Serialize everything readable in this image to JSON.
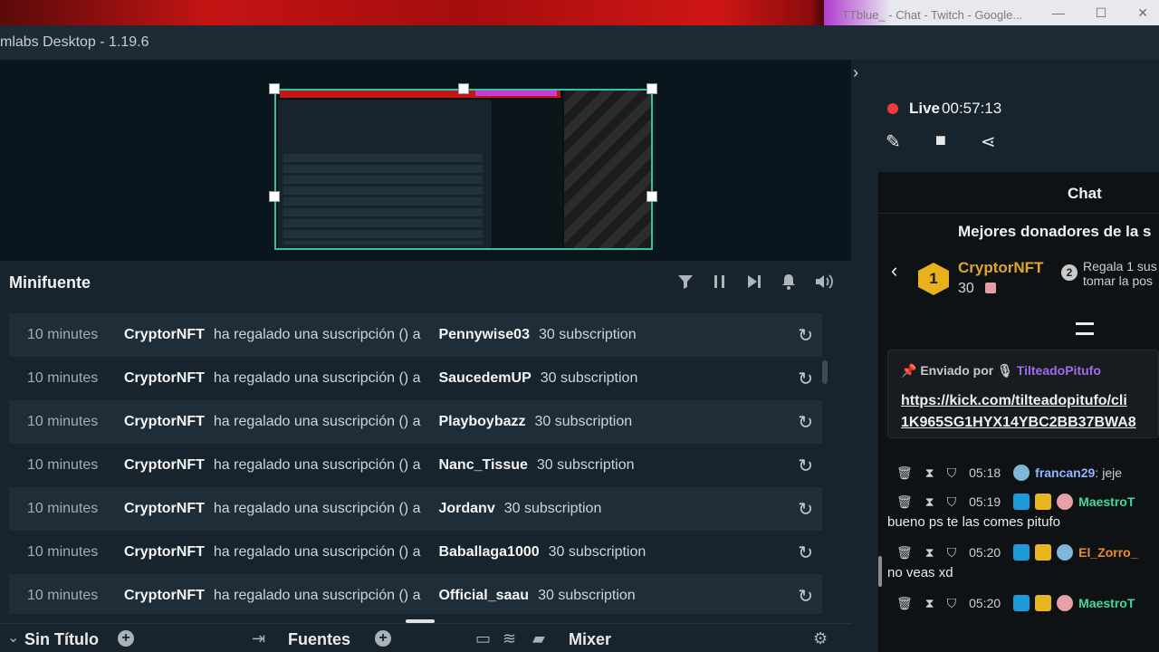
{
  "browser": {
    "chrome_tab_title": "TTblue_ - Chat - Twitch - Google...",
    "min_glyph": "—",
    "max_glyph": "☐",
    "close_glyph": "✕"
  },
  "app": {
    "title": "mlabs Desktop - 1.19.6"
  },
  "minifeed": {
    "title": "Minifuente",
    "controls": [
      "filter-icon",
      "pause-icon",
      "skip-icon",
      "bell-icon",
      "volume-icon"
    ],
    "events": [
      {
        "time": "10 minutes",
        "from": "CryptorNFT",
        "message": "ha regalado una suscripción () a",
        "to": "Pennywise03",
        "amount": "30 subscription"
      },
      {
        "time": "10 minutes",
        "from": "CryptorNFT",
        "message": "ha regalado una suscripción () a",
        "to": "SaucedemUP",
        "amount": "30 subscription"
      },
      {
        "time": "10 minutes",
        "from": "CryptorNFT",
        "message": "ha regalado una suscripción () a",
        "to": "Playboybazz",
        "amount": "30 subscription"
      },
      {
        "time": "10 minutes",
        "from": "CryptorNFT",
        "message": "ha regalado una suscripción () a",
        "to": "Nanc_Tissue",
        "amount": "30 subscription"
      },
      {
        "time": "10 minutes",
        "from": "CryptorNFT",
        "message": "ha regalado una suscripción () a",
        "to": "Jordanv",
        "amount": "30 subscription"
      },
      {
        "time": "10 minutes",
        "from": "CryptorNFT",
        "message": "ha regalado una suscripción () a",
        "to": "Baballaga1000",
        "amount": "30 subscription"
      },
      {
        "time": "10 minutes",
        "from": "CryptorNFT",
        "message": "ha regalado una suscripción () a",
        "to": "Official_saau",
        "amount": "30 subscription"
      }
    ]
  },
  "bottombar": {
    "scene": "Sin Título",
    "sources": "Fuentes",
    "mixer": "Mixer"
  },
  "live": {
    "label": "Live",
    "time": "00:57:13"
  },
  "chat": {
    "title": "Chat",
    "donors_title": "Mejores donadores de la s",
    "top_donor": {
      "rank": "1",
      "name": "CryptorNFT",
      "count": "30"
    },
    "second": {
      "rank": "2",
      "line1": "Regala 1 sus",
      "line2": "tomar la pos"
    },
    "pinned": {
      "label": "Enviado por",
      "user": "TilteadoPitufo",
      "link_line1": "https://kick.com/tilteadopitufo/cli",
      "link_line2": "1K965SG1HYX14YBC2BB37BWA8"
    },
    "messages": [
      {
        "time": "05:18",
        "user": "francan29",
        "user_color": "#8fb7ff",
        "text": "jeje",
        "inline": true
      },
      {
        "time": "05:19",
        "user": "MaestroT",
        "user_color": "#3fd9a0",
        "text": "bueno ps te las comes pitufo",
        "inline": false
      },
      {
        "time": "05:20",
        "user": "El_Zorro_",
        "user_color": "#f08a2a",
        "text": "no veas xd",
        "inline": false
      },
      {
        "time": "05:20",
        "user": "MaestroT",
        "user_color": "#3fd9a0",
        "text": "",
        "inline": false
      }
    ]
  }
}
